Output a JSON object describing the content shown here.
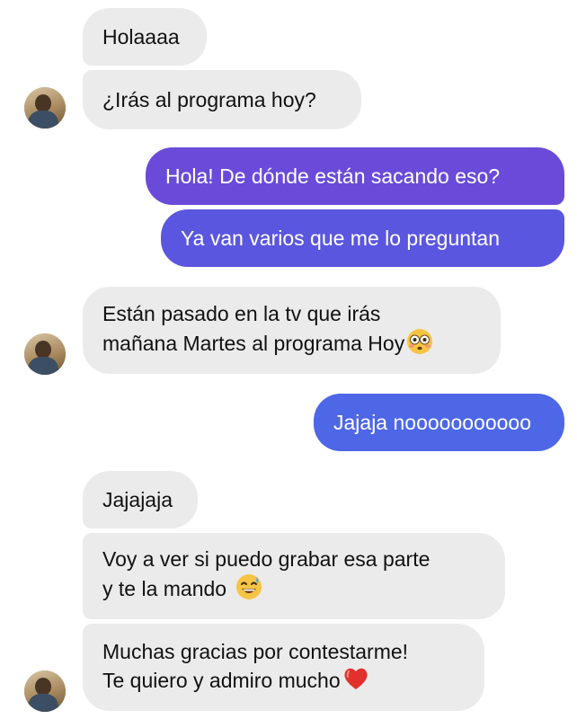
{
  "messages": [
    {
      "id": "m1",
      "from": "them",
      "text": "Holaaaa"
    },
    {
      "id": "m2",
      "from": "them",
      "text": "¿Irás al programa hoy?"
    },
    {
      "id": "m3",
      "from": "me",
      "text": "Hola! De dónde están sacando eso?"
    },
    {
      "id": "m4",
      "from": "me",
      "text": "Ya van varios que me lo preguntan"
    },
    {
      "id": "m5",
      "from": "them",
      "lines": [
        "Están pasado en la tv que irás",
        "mañana Martes al programa Hoy"
      ],
      "emoji": "flushed-face-emoji"
    },
    {
      "id": "m6",
      "from": "me",
      "text": "Jajaja nooooooooooo"
    },
    {
      "id": "m7",
      "from": "them",
      "text": "Jajajaja"
    },
    {
      "id": "m8",
      "from": "them",
      "lines": [
        "Voy a ver si puedo grabar esa parte",
        "y te la mando"
      ],
      "emoji": "grinning-sweat-emoji"
    },
    {
      "id": "m9",
      "from": "them",
      "lines": [
        "Muchas gracias por contestarme!",
        "Te quiero y admiro mucho"
      ],
      "emoji": "red-heart-emoji"
    }
  ],
  "colors": {
    "incoming_bubble": "#ebebeb",
    "incoming_text": "#111111",
    "outgoing_top": "#6e48d8",
    "outgoing_bottom": "#4d66e6",
    "outgoing_text": "#ffffff"
  },
  "avatar": {
    "icon": "contact-avatar-photo"
  }
}
